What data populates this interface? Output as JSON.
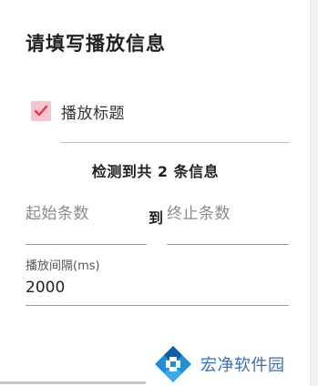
{
  "dialog": {
    "title": "请填写播放信息",
    "checkbox": {
      "label": "播放标题",
      "checked": true,
      "icon": "check-icon",
      "color": "#f3c6cf",
      "check_color": "#e2334f"
    },
    "title_input": {
      "value": ""
    },
    "detected_text": "检测到共 2 条信息",
    "range": {
      "start_placeholder": "起始条数",
      "separator": "到",
      "end_placeholder": "终止条数"
    },
    "interval": {
      "label": "播放间隔(ms)",
      "value": "2000"
    }
  },
  "watermark": {
    "text": "宏净软件园",
    "icon": "logo-icon",
    "color": "#3f6fb0"
  }
}
